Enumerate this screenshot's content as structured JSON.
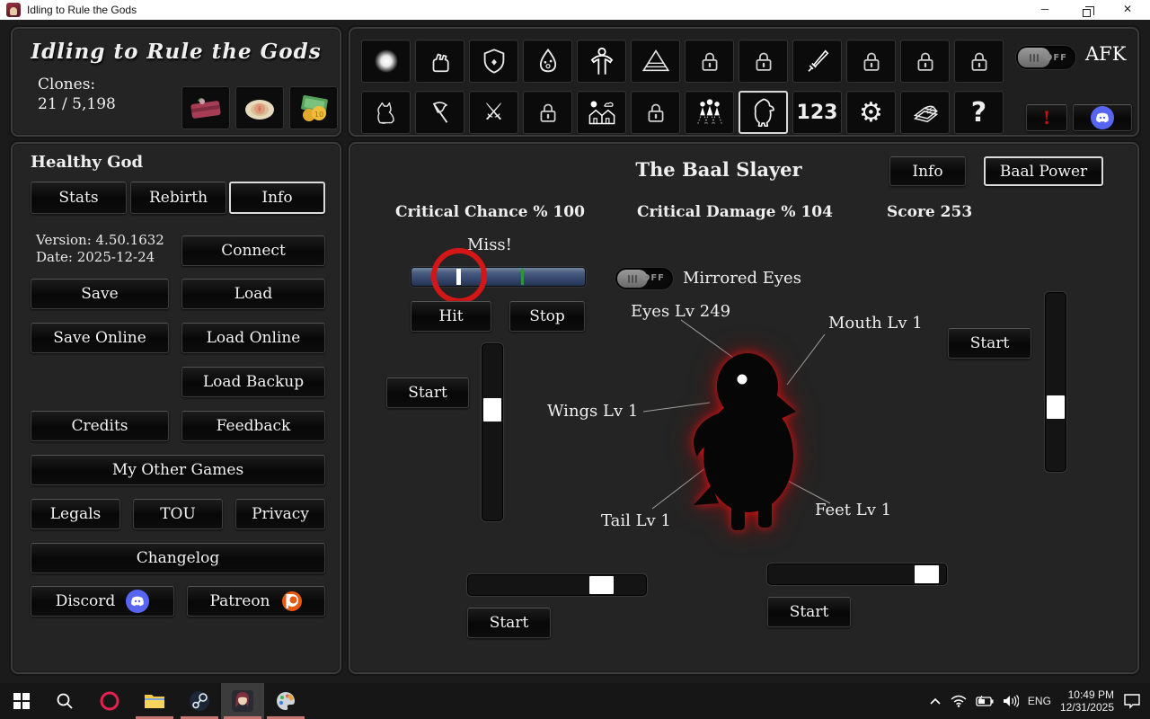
{
  "window": {
    "title": "Idling to Rule the Gods",
    "minimize_glyph": "─",
    "close_glyph": "✕"
  },
  "clones_panel": {
    "logo_text": "Idling to Rule the Gods",
    "clones_label": "Clones:",
    "clones_value": "21 / 5,198",
    "items": [
      "gift",
      "nest",
      "money"
    ]
  },
  "icon_bar": {
    "row1": [
      "light",
      "fist",
      "shield",
      "blob",
      "body",
      "pyramid",
      "lock",
      "lock",
      "sword",
      "lock",
      "lock",
      "lock"
    ],
    "row2": [
      "cat",
      "flag",
      "crossed-swords",
      "lock",
      "village",
      "lock",
      "population",
      "pet-selected",
      "numbers",
      "settings",
      "book",
      "help"
    ],
    "numbers_label": "123",
    "help_label": "?",
    "afk_label": "AFK",
    "afk_state": "OFF"
  },
  "sidebar": {
    "god_name": "Healthy God",
    "tabs": [
      {
        "label": "Stats"
      },
      {
        "label": "Rebirth"
      },
      {
        "label": "Info",
        "selected": true
      }
    ],
    "version_text": "Version: 4.50.1632",
    "date_text": "Date: 2025-12-24",
    "buttons": {
      "connect": "Connect",
      "save": "Save",
      "load": "Load",
      "save_online": "Save Online",
      "load_online": "Load Online",
      "load_backup": "Load Backup",
      "credits": "Credits",
      "feedback": "Feedback",
      "my_other_games": "My Other Games",
      "legals": "Legals",
      "tou": "TOU",
      "privacy": "Privacy",
      "changelog": "Changelog",
      "discord": "Discord",
      "patreon": "Patreon"
    }
  },
  "main": {
    "title": "The Baal Slayer",
    "info_button": "Info",
    "baal_power_button": "Baal Power",
    "critical_chance": "Critical Chance % 100",
    "critical_damage": "Critical Damage % 104",
    "score": "Score 253",
    "miss_text": "Miss!",
    "hit_button": "Hit",
    "stop_button": "Stop",
    "mirrored_eyes_label": "Mirrored Eyes",
    "mirrored_eyes_state": "OFF",
    "start_label": "Start",
    "parts": {
      "eyes": "Eyes Lv 249",
      "mouth": "Mouth Lv 1",
      "wings": "Wings Lv 1",
      "tail": "Tail Lv 1",
      "feet": "Feet Lv 1"
    }
  },
  "taskbar": {
    "language": "ENG",
    "time": "10:49 PM",
    "date": "12/31/2025",
    "apps": [
      "start",
      "search",
      "opera",
      "explorer",
      "steam",
      "game",
      "paint"
    ]
  },
  "colors": {
    "annotation_red": "#d31616",
    "slider_blue": "#46597e",
    "target_green": "#2f9440",
    "discord_blue": "#5865F2",
    "patreon_orange": "#e85b1a",
    "running_indicator": "#c97672"
  }
}
